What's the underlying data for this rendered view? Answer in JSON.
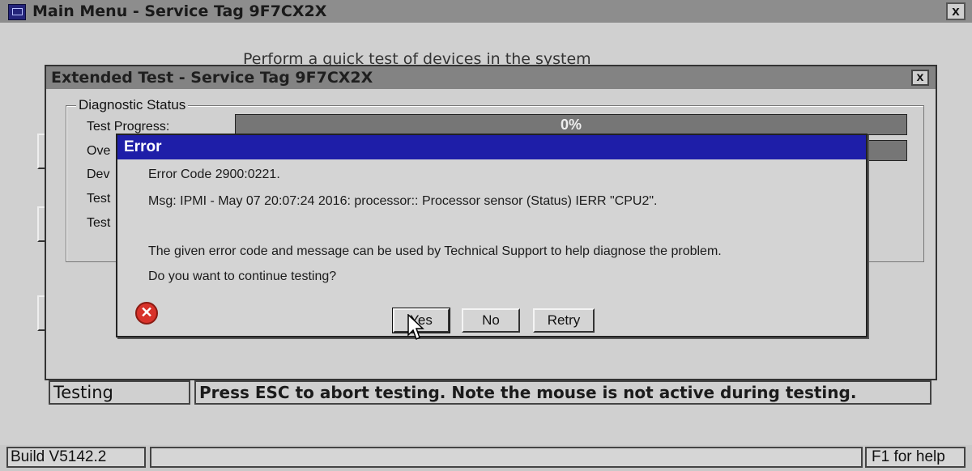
{
  "main_window": {
    "title": "Main Menu - Service Tag 9F7CX2X",
    "close_label": "x",
    "partial_text": "Perform a quick test of devices in the system"
  },
  "extended_test": {
    "title": "Extended Test - Service Tag 9F7CX2X",
    "close_label": "x",
    "group_label": "Diagnostic Status",
    "rows": [
      "Test Progress:",
      "Ove",
      "Dev",
      "Test",
      "Test"
    ],
    "progress_value": 0,
    "progress_text": "0%",
    "status_left": "Testing",
    "status_right": "Press ESC to abort testing.  Note the mouse is not active during testing."
  },
  "bottom_bar": {
    "build": "Build  V5142.2",
    "help": "F1 for help"
  },
  "error_dialog": {
    "title": "Error",
    "error_code": "Error Code  2900:0221.",
    "message": "Msg: IPMI - May 07 20:07:24 2016: processor:: Processor sensor (Status) IERR \"CPU2\".",
    "explanation": "The given error code and message can be used by Technical Support to help diagnose the problem.",
    "question": "Do you want to continue testing?",
    "icon": "error-x-icon",
    "buttons": {
      "yes": "Yes",
      "no": "No",
      "retry": "Retry"
    }
  },
  "colors": {
    "error_title_bg": "#1e1ea8",
    "window_bg": "#d0d0d0",
    "progress_bg": "#767676"
  }
}
